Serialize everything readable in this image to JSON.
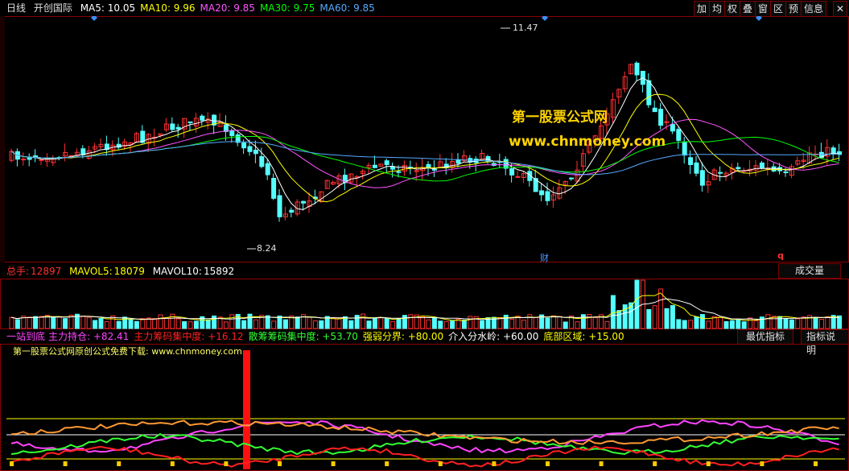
{
  "price_header": {
    "period": "日线",
    "stock": "开创国际",
    "ma": [
      {
        "label": "MA5:",
        "value": "10.05",
        "color": "#ffffff"
      },
      {
        "label": "MA10:",
        "value": "9.96",
        "color": "#ffff00"
      },
      {
        "label": "MA20:",
        "value": "9.85",
        "color": "#ff55ff"
      },
      {
        "label": "MA30:",
        "value": "9.75",
        "color": "#00ff00"
      },
      {
        "label": "MA60:",
        "value": "9.85",
        "color": "#55aaff"
      }
    ]
  },
  "toolbar": [
    "加",
    "均",
    "权",
    "叠",
    "窗",
    "区",
    "预",
    "信息"
  ],
  "price_annotations": {
    "high": "11.47",
    "low": "8.24",
    "cai": "财",
    "q": "q"
  },
  "watermark": {
    "line1": "第一股票公式网",
    "line2": "www.chnmoney.com"
  },
  "volume_header": {
    "label": "总手:",
    "value": "12897",
    "mavol5_label": "MAVOL5:",
    "mavol5": "18079",
    "mavol10_label": "MAVOL10:",
    "mavol10": "15892",
    "button": "成交量"
  },
  "indicator_header": {
    "name": "一站到底",
    "items": [
      {
        "label": "主力持仓:",
        "value": "+82.41",
        "color": "#ff44ff"
      },
      {
        "label": "主力筹码集中度:",
        "value": "+16.12",
        "color": "#ff2020"
      },
      {
        "label": "散筹筹码集中度:",
        "value": "+53.70",
        "color": "#33ff33"
      },
      {
        "label": "强弱分界:",
        "value": "+80.00",
        "color": "#ffff00"
      },
      {
        "label": "介入分水岭:",
        "value": "+60.00",
        "color": "#ffffff"
      },
      {
        "label": "底部区域:",
        "value": "+15.00",
        "color": "#ffff00"
      }
    ],
    "btn_best": "最优指标",
    "btn_help": "指标说明",
    "promo": "第一股票公式网原创公式免费下载: www.chnmoney.com"
  },
  "colors": {
    "up": "#ff3232",
    "down": "#54ffff",
    "frame": "#8b0000"
  }
}
